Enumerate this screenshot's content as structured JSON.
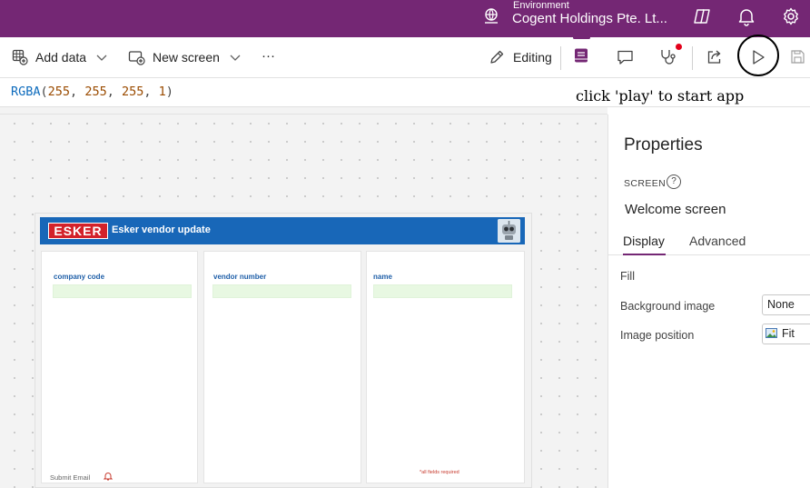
{
  "topbar": {
    "environment_label": "Environment",
    "environment_name": "Cogent Holdings Pte. Lt...",
    "icons": [
      "environment-icon",
      "copilot-icon",
      "notifications-icon",
      "settings-icon"
    ]
  },
  "toolbar": {
    "add_data": "Add data",
    "new_screen": "New screen",
    "more": "···",
    "editing": "Editing",
    "icons": [
      "tree-view-icon",
      "comments-icon",
      "app-checker-icon",
      "share-icon",
      "play-icon",
      "save-icon"
    ]
  },
  "formula": {
    "fn": "RGBA",
    "args": [
      "255",
      "255",
      "255",
      "1"
    ]
  },
  "annotation": "click 'play' to start app",
  "app": {
    "logo_text": "ESKER",
    "title": "Esker vendor update",
    "fields": [
      {
        "label": "company code"
      },
      {
        "label": "vendor number"
      },
      {
        "label": "name"
      }
    ],
    "submit_label": "Submit Email",
    "required_note": "*all fields required"
  },
  "properties": {
    "title": "Properties",
    "kind": "SCREEN",
    "help": "?",
    "name": "Welcome screen",
    "tabs": [
      "Display",
      "Advanced"
    ],
    "active_tab": "Display",
    "rows": [
      {
        "label": "Fill",
        "value": ""
      },
      {
        "label": "Background image",
        "value": "None"
      },
      {
        "label": "Image position",
        "value": "Fit"
      }
    ]
  },
  "colors": {
    "brand_purple": "#742774",
    "app_header_blue": "#1867b8",
    "esker_red": "#d3222a",
    "input_green": "#e8f8e2"
  }
}
